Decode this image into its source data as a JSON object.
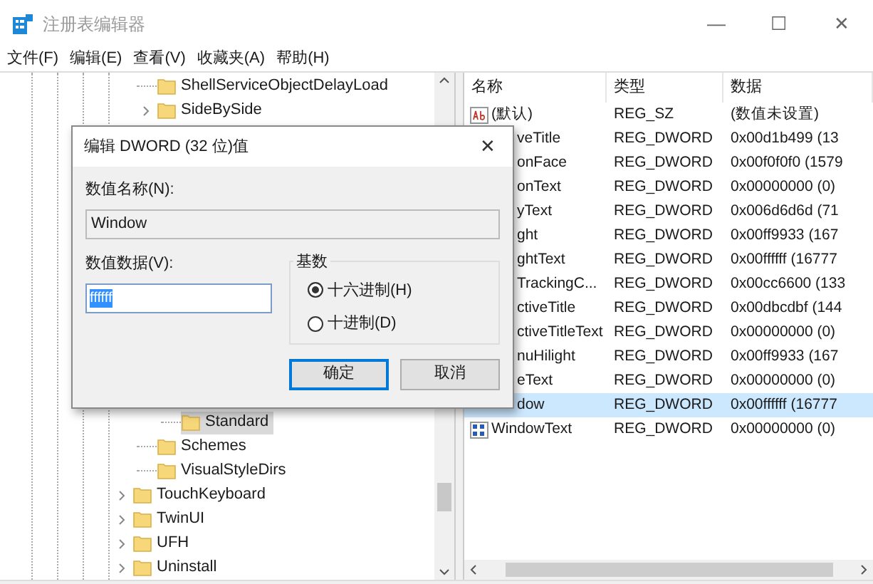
{
  "window": {
    "title": "注册表编辑器",
    "controls": [
      "—",
      "☐",
      "✕"
    ]
  },
  "menu": [
    "文件(F)",
    "编辑(E)",
    "查看(V)",
    "收藏夹(A)",
    "帮助(H)"
  ],
  "tree": {
    "top_items": [
      {
        "label": "ShellServiceObjectDelayLoad",
        "expandable": false,
        "selected": false
      },
      {
        "label": "SideBySide",
        "expandable": true,
        "selected": false
      }
    ],
    "bottom_items": [
      {
        "children": [
          {
            "children": [
              {
                "label": "Standard",
                "expandable": false,
                "selected": true
              }
            ]
          },
          {
            "label": "Schemes",
            "expandable": false,
            "selected": false
          },
          {
            "label": "VisualStyleDirs",
            "expandable": false,
            "selected": false
          }
        ]
      },
      {
        "label": "TouchKeyboard",
        "expandable": true,
        "selected": false
      },
      {
        "label": "TwinUI",
        "expandable": true,
        "selected": false
      },
      {
        "label": "UFH",
        "expandable": true,
        "selected": false
      },
      {
        "label": "Uninstall",
        "expandable": true,
        "selected": false
      }
    ]
  },
  "list": {
    "columns": [
      "名称",
      "类型",
      "数据"
    ],
    "rows": [
      {
        "name": "(默认)",
        "kind": "string",
        "type": "REG_SZ",
        "data": "(数值未设置)",
        "selected": false
      },
      {
        "name": "veTitle",
        "kind": "dword",
        "type": "REG_DWORD",
        "data": "0x00d1b499 (13",
        "selected": false
      },
      {
        "name": "onFace",
        "kind": "dword",
        "type": "REG_DWORD",
        "data": "0x00f0f0f0 (1579",
        "selected": false
      },
      {
        "name": "onText",
        "kind": "dword",
        "type": "REG_DWORD",
        "data": "0x00000000 (0)",
        "selected": false
      },
      {
        "name": "yText",
        "kind": "dword",
        "type": "REG_DWORD",
        "data": "0x006d6d6d (71",
        "selected": false
      },
      {
        "name": "ght",
        "kind": "dword",
        "type": "REG_DWORD",
        "data": "0x00ff9933 (167",
        "selected": false
      },
      {
        "name": "ghtText",
        "kind": "dword",
        "type": "REG_DWORD",
        "data": "0x00ffffff (16777",
        "selected": false
      },
      {
        "name": "TrackingC...",
        "kind": "dword",
        "type": "REG_DWORD",
        "data": "0x00cc6600 (133",
        "selected": false
      },
      {
        "name": "ctiveTitle",
        "kind": "dword",
        "type": "REG_DWORD",
        "data": "0x00dbcdbf (144",
        "selected": false
      },
      {
        "name": "ctiveTitleText",
        "kind": "dword",
        "type": "REG_DWORD",
        "data": "0x00000000 (0)",
        "selected": false
      },
      {
        "name": "nuHilight",
        "kind": "dword",
        "type": "REG_DWORD",
        "data": "0x00ff9933 (167",
        "selected": false
      },
      {
        "name": "eText",
        "kind": "dword",
        "type": "REG_DWORD",
        "data": "0x00000000 (0)",
        "selected": false
      },
      {
        "name": "dow",
        "kind": "dword",
        "type": "REG_DWORD",
        "data": "0x00ffffff (16777",
        "selected": true
      },
      {
        "name": "WindowText",
        "kind": "dword",
        "type": "REG_DWORD",
        "data": "0x00000000 (0)",
        "selected": false
      }
    ]
  },
  "dialog": {
    "title": "编辑 DWORD (32 位)值",
    "close": "✕",
    "name_label": "数值名称(N):",
    "name_value": "Window",
    "data_label": "数值数据(V):",
    "data_value": "ffffff",
    "base_label": "基数",
    "radios": [
      {
        "label": "十六进制(H)",
        "selected": true
      },
      {
        "label": "十进制(D)",
        "selected": false
      }
    ],
    "buttons": [
      {
        "label": "确定",
        "focused": true
      },
      {
        "label": "取消",
        "focused": false
      }
    ]
  }
}
